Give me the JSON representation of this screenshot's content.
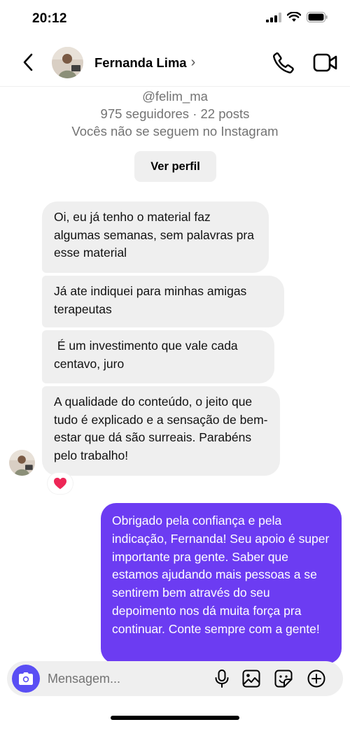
{
  "status_bar": {
    "time": "20:12"
  },
  "header": {
    "name": "Fernanda Lima",
    "chevron": "›"
  },
  "profile": {
    "handle": "@felim_ma",
    "stats": "975 seguidores · 22 posts",
    "follow_status": "Vocês não se seguem no Instagram",
    "view_profile_label": "Ver perfil"
  },
  "messages": {
    "received": [
      "Oi, eu já tenho o material faz algumas semanas, sem palavras pra esse material",
      "Já ate indiquei para minhas amigas terapeutas",
      " É um investimento que vale cada centavo, juro",
      "A qualidade do conteúdo, o jeito que tudo é explicado e a sensação de bem-estar que dá são surreais. Parabéns pelo trabalho!"
    ],
    "reaction": "heart",
    "sent": "Obrigado pela confiança e pela indicação, Fernanda! Seu apoio é super importante pra gente. Saber que estamos ajudando mais pessoas a se sentirem bem através do seu depoimento nos dá muita força pra continuar. Conte sempre com a gente!"
  },
  "composer": {
    "placeholder": "Mensagem...",
    "value": ""
  },
  "colors": {
    "sent_bubble": "#6c3cf2",
    "received_bubble": "#efefef",
    "camera_button": "#5a4ef4",
    "heart": "#ed2656"
  },
  "icons": [
    "back-icon",
    "phone-icon",
    "video-icon",
    "camera-icon",
    "microphone-icon",
    "gallery-icon",
    "sticker-icon",
    "plus-icon",
    "heart-icon"
  ]
}
